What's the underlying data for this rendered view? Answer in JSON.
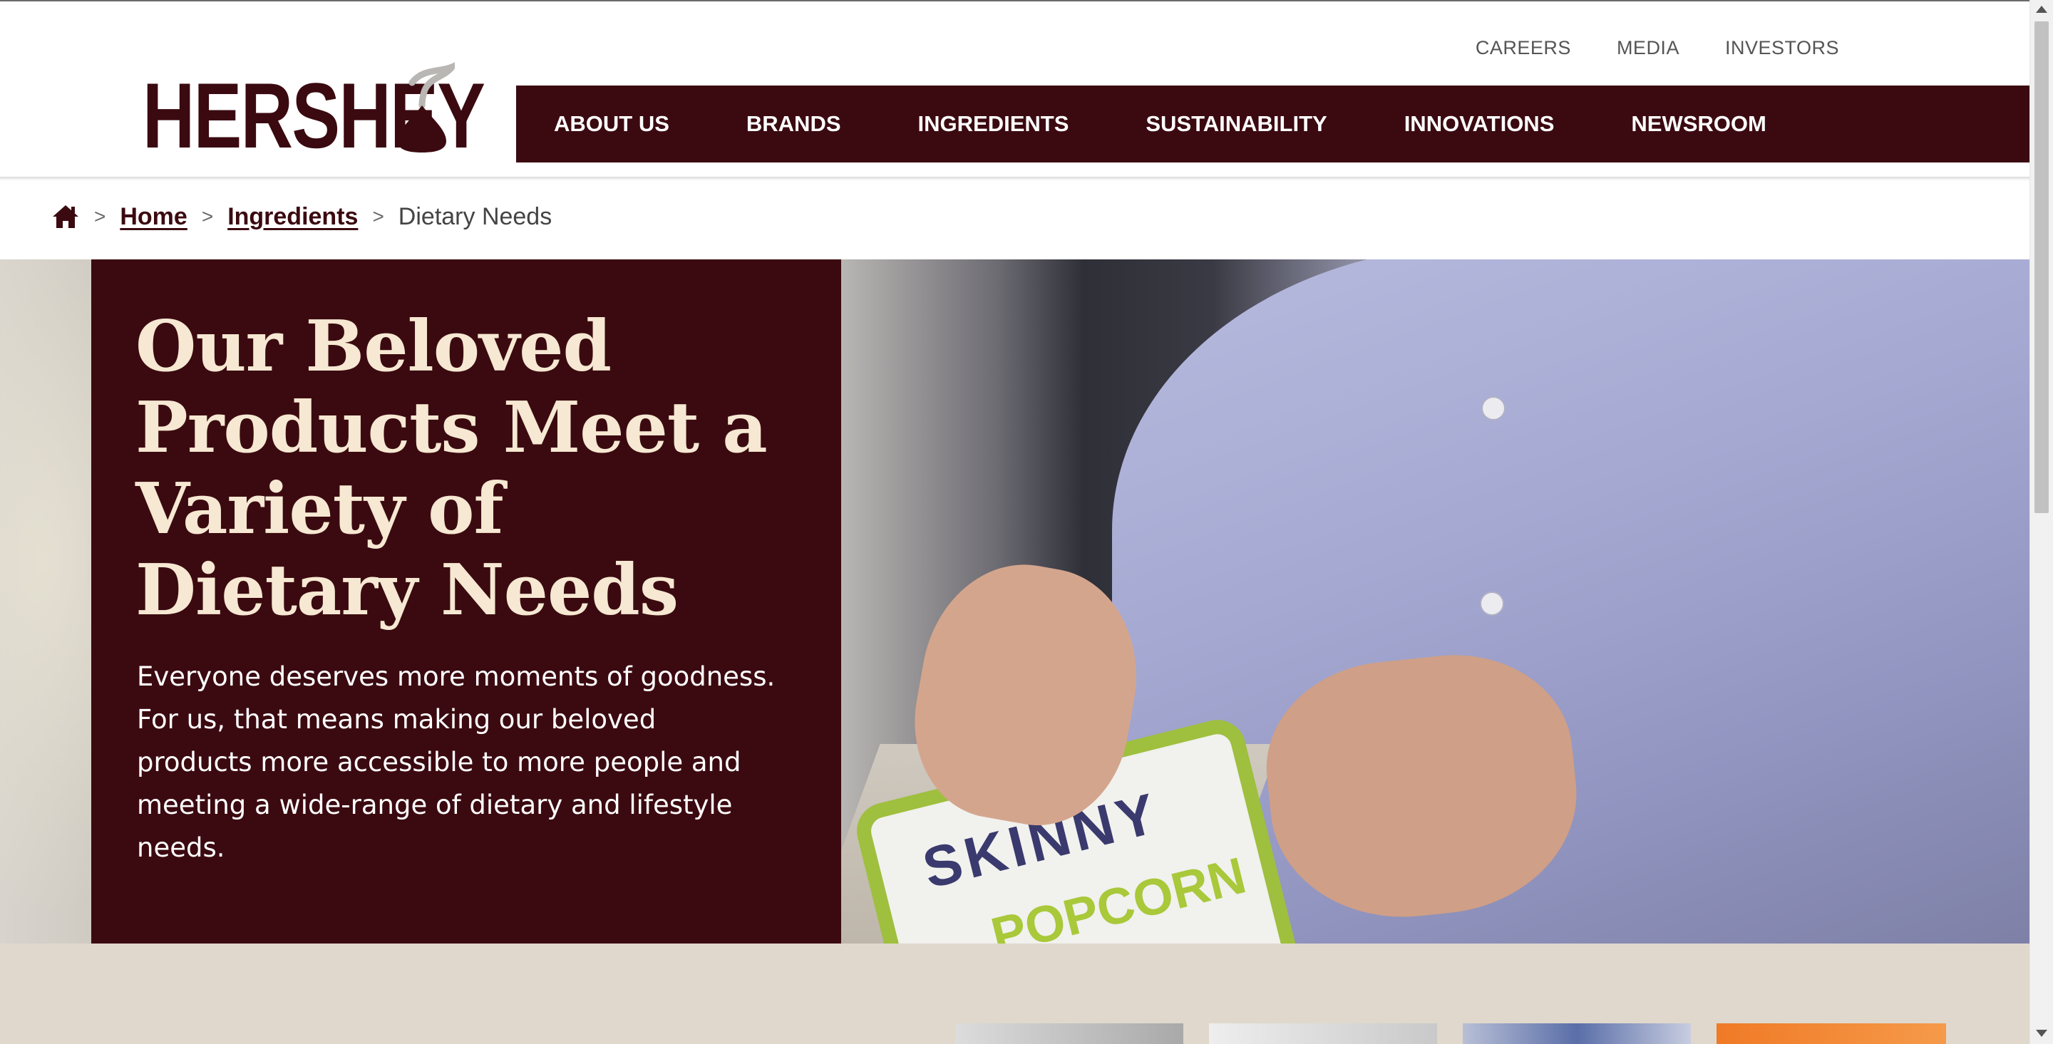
{
  "brand": {
    "logo_text": "HERSHEY"
  },
  "utility_nav": {
    "items": [
      "CAREERS",
      "MEDIA",
      "INVESTORS"
    ]
  },
  "main_nav": {
    "items": [
      "ABOUT US",
      "BRANDS",
      "INGREDIENTS",
      "SUSTAINABILITY",
      "INNOVATIONS",
      "NEWSROOM"
    ]
  },
  "breadcrumb": {
    "separator": ">",
    "items": [
      {
        "label": "Home"
      },
      {
        "label": "Ingredients"
      },
      {
        "label": "Dietary Needs"
      }
    ]
  },
  "hero": {
    "title": "Our Beloved Products Meet a Variety of Dietary Needs",
    "body": "Everyone deserves more moments of goodness. For us, that means making our beloved products more accessible to more people and meeting a wide-range of dietary and lifestyle needs.",
    "image_bag_text_1": "SKINNY",
    "image_bag_text_2": "POPCORN"
  },
  "colors": {
    "brand_maroon": "#3b0a10",
    "title_cream": "#f6e8d2",
    "band_beige": "#e0d8cc"
  },
  "icons": {
    "home": "home-icon",
    "search": "search-icon"
  }
}
